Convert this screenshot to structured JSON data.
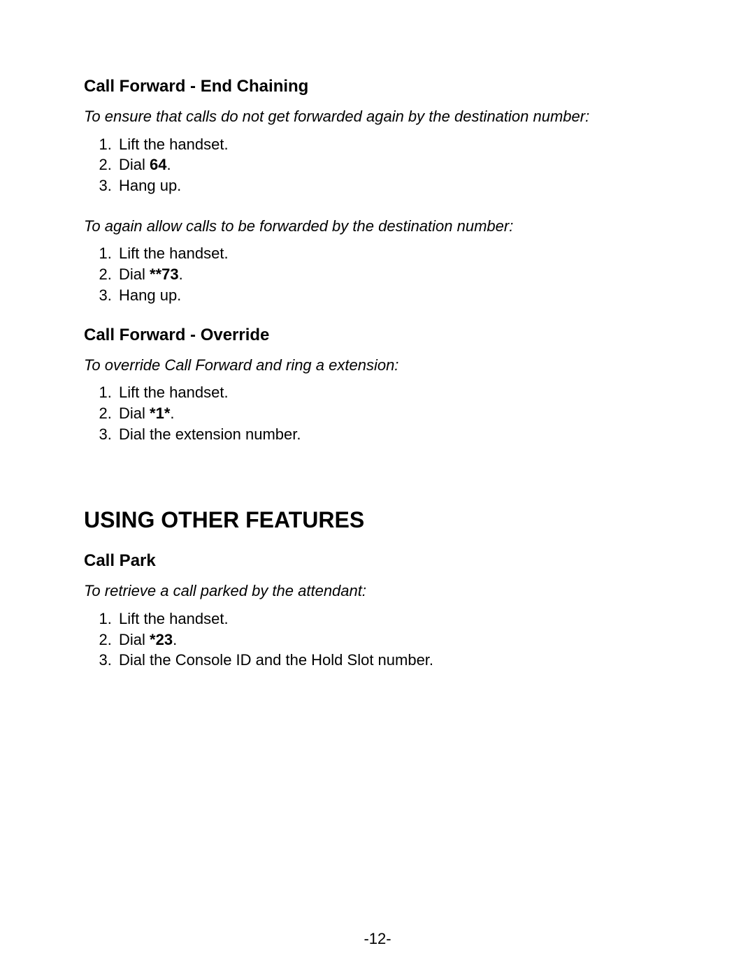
{
  "section1": {
    "heading": "Call Forward - End Chaining",
    "intro1": "To ensure that calls do not get forwarded again by the destination number:",
    "steps1": {
      "s1": "Lift the handset.",
      "s2_prefix": "Dial ",
      "s2_code": "64",
      "s2_suffix": ".",
      "s3": "Hang up."
    },
    "intro2": "To again allow calls to be forwarded by the destination number:",
    "steps2": {
      "s1": "Lift the handset.",
      "s2_prefix": "Dial ",
      "s2_code": "**73",
      "s2_suffix": ".",
      "s3": "Hang up."
    }
  },
  "section2": {
    "heading": "Call Forward - Override",
    "intro": "To override Call Forward and ring a extension:",
    "steps": {
      "s1": "Lift the handset.",
      "s2_prefix": "Dial ",
      "s2_code": "*1*",
      "s2_suffix": ".",
      "s3": "Dial the extension number."
    }
  },
  "major": "USING OTHER FEATURES",
  "section3": {
    "heading": "Call Park",
    "intro": "To retrieve a call parked by the attendant:",
    "steps": {
      "s1": "Lift the handset.",
      "s2_prefix": "Dial ",
      "s2_code": "*23",
      "s2_suffix": ".",
      "s3": "Dial the Console ID and the Hold Slot number."
    }
  },
  "page_number": "-12-"
}
